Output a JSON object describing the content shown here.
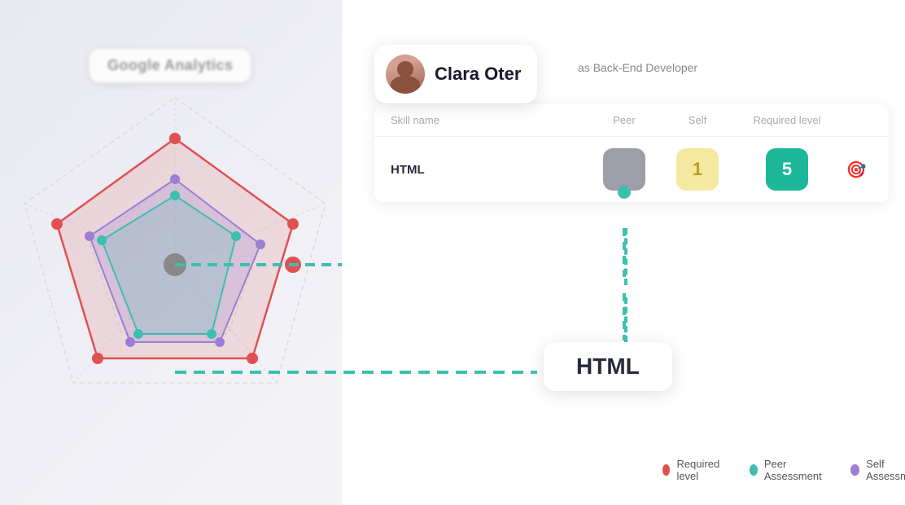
{
  "page": {
    "background_color": "#f0f0f5",
    "accent_teal": "#3dbfb0",
    "accent_red": "#e05050",
    "accent_purple": "#9b7fd4"
  },
  "google_analytics_badge": {
    "label": "Google Analytics"
  },
  "profile": {
    "name": "Clara Oter",
    "role_prefix": "as",
    "role": "Back-End Developer",
    "avatar_alt": "Clara Oter avatar"
  },
  "table": {
    "headers": {
      "skill_name": "Skill name",
      "peer": "Peer",
      "self": "Self",
      "required_level": "Required level"
    },
    "rows": [
      {
        "skill": "HTML",
        "peer_score": "",
        "self_score": "1",
        "required_score": "5"
      }
    ]
  },
  "html_label": {
    "text": "HTML"
  },
  "legend": {
    "items": [
      {
        "label": "Required level",
        "color": "#e05050",
        "type": "circle"
      },
      {
        "label": "Peer Assessment",
        "color": "#3dbfb0",
        "type": "circle"
      },
      {
        "label": "Self Assessment",
        "color": "#9b7fd4",
        "type": "circle"
      }
    ]
  }
}
